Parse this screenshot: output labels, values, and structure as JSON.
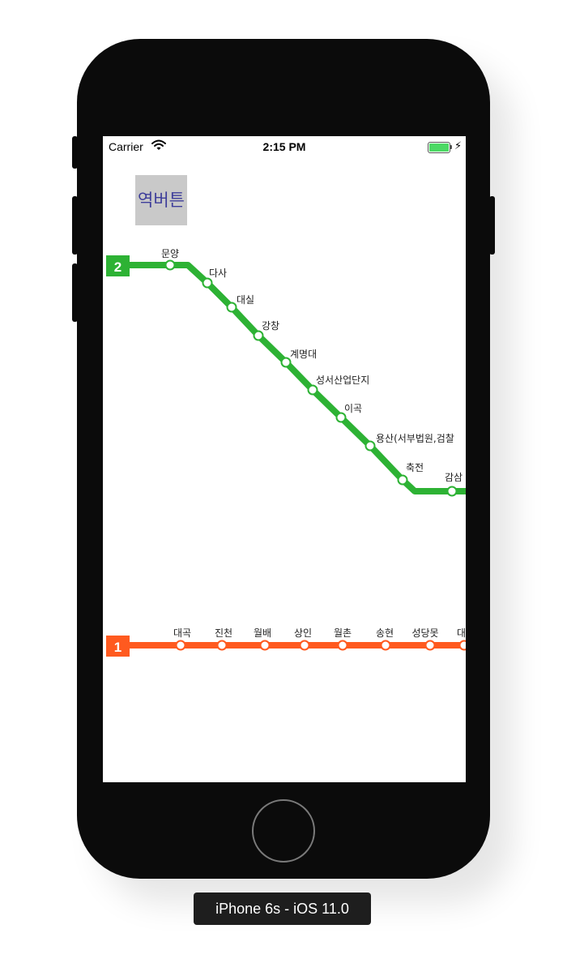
{
  "status_bar": {
    "carrier": "Carrier",
    "time": "2:15 PM",
    "battery_color": "#4cd964"
  },
  "station_button": {
    "label": "역버튼"
  },
  "line2": {
    "number": "2",
    "color": "#2db234",
    "stations": [
      "문양",
      "다사",
      "대실",
      "강창",
      "계명대",
      "성서산업단지",
      "이곡",
      "용산(서부법원,검찰",
      "축전",
      "감삼"
    ]
  },
  "line1": {
    "number": "1",
    "color": "#ff5a1f",
    "stations": [
      "대곡",
      "진천",
      "월배",
      "상인",
      "월촌",
      "송현",
      "성당못",
      "대"
    ]
  },
  "device_label": "iPhone 6s - iOS 11.0"
}
